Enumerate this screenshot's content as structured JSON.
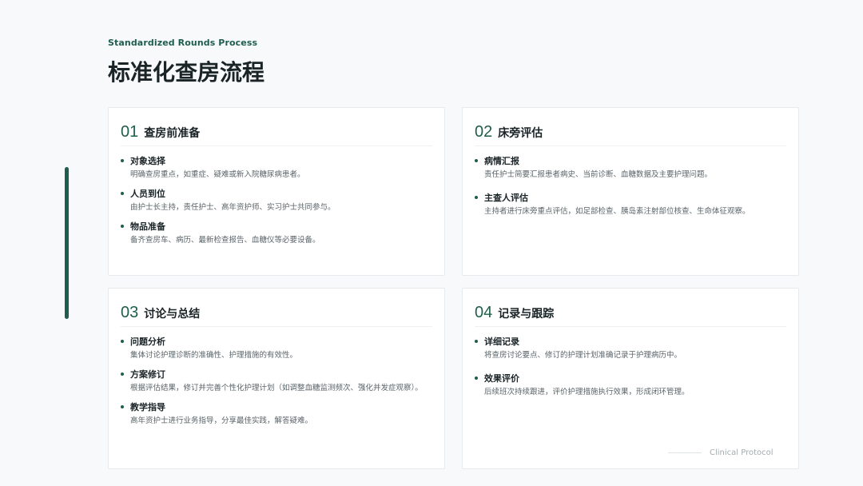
{
  "header": {
    "subtitle": "Standardized Rounds Process",
    "title": "标准化查房流程"
  },
  "cards": [
    {
      "num": "01",
      "title": "查房前准备",
      "items": [
        {
          "title": "对象选择",
          "desc": "明确查房重点，如重症、疑难或新入院糖尿病患者。"
        },
        {
          "title": "人员到位",
          "desc": "由护士长主持，责任护士、高年资护师、实习护士共同参与。"
        },
        {
          "title": "物品准备",
          "desc": "备齐查房车、病历、最新检查报告、血糖仪等必要设备。"
        }
      ]
    },
    {
      "num": "02",
      "title": "床旁评估",
      "items": [
        {
          "title": "病情汇报",
          "desc": "责任护士简要汇报患者病史、当前诊断、血糖数据及主要护理问题。"
        },
        {
          "title": "主查人评估",
          "desc": "主持者进行床旁重点评估，如足部检查、胰岛素注射部位核查、生命体征观察。"
        }
      ]
    },
    {
      "num": "03",
      "title": "讨论与总结",
      "items": [
        {
          "title": "问题分析",
          "desc": "集体讨论护理诊断的准确性、护理措施的有效性。"
        },
        {
          "title": "方案修订",
          "desc": "根据评估结果，修订并完善个性化护理计划（如调整血糖监测频次、强化并发症观察）。"
        },
        {
          "title": "教学指导",
          "desc": "高年资护士进行业务指导，分享最佳实践，解答疑难。"
        }
      ]
    },
    {
      "num": "04",
      "title": "记录与跟踪",
      "items": [
        {
          "title": "详细记录",
          "desc": "将查房讨论要点、修订的护理计划准确记录于护理病历中。"
        },
        {
          "title": "效果评价",
          "desc": "后续班次持续跟进，评价护理措施执行效果，形成闭环管理。"
        }
      ]
    }
  ],
  "footer": {
    "text": "Clinical Protocol"
  },
  "colors": {
    "accent": "#1f5e4c",
    "background": "#f7f9fb"
  }
}
